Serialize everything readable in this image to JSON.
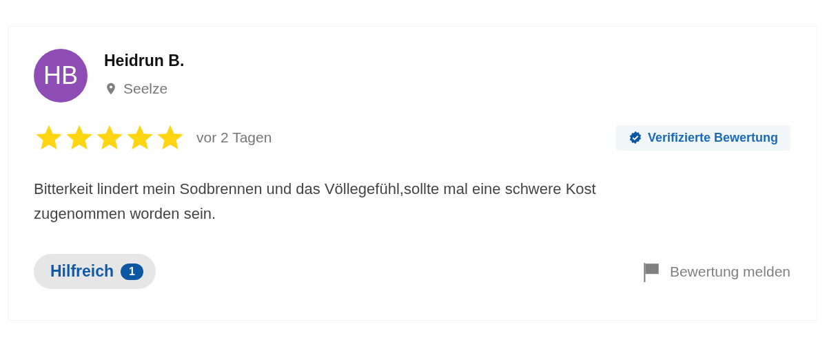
{
  "review": {
    "avatar_initials": "HB",
    "author": "Heidrun B.",
    "location": "Seelze",
    "stars": 5,
    "date": "vor 2 Tagen",
    "verified": true,
    "verified_label": "Verifizierte Bewertung",
    "text": "Bitterkeit lindert mein Sodbrennen und das Völlegefühl,sollte mal eine schwere Kost zugenommen worden sein.",
    "helpful_label": "Hilfreich",
    "helpful_count": "1",
    "report_label": "Bewertung melden"
  }
}
